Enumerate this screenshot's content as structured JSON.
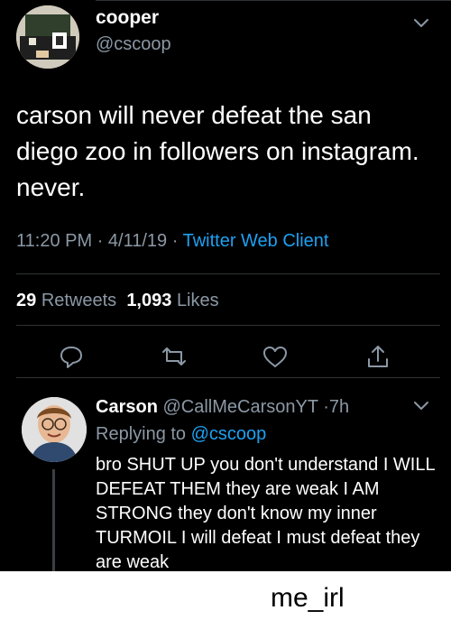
{
  "tweet": {
    "author_name": "cooper",
    "author_handle": "@cscoop",
    "text": "carson will never defeat the san diego zoo in followers on instagram. never.",
    "time": "11:20 PM",
    "date": "4/11/19",
    "source": "Twitter Web Client",
    "retweet_count": "29",
    "retweet_label": "Retweets",
    "like_count": "1,093",
    "like_label": "Likes"
  },
  "reply": {
    "author_name": "Carson",
    "author_handle": "@CallMeCarsonYT",
    "age": "7h",
    "replying_label": "Replying to",
    "replying_to": "@cscoop",
    "text": "bro SHUT UP you don't understand I WILL DEFEAT THEM they are weak I AM STRONG they don't know my inner TURMOIL I will defeat I must defeat they are weak"
  },
  "caption": "me_irl",
  "icons": [
    "chevron-down-icon",
    "reply-icon",
    "retweet-icon",
    "like-icon",
    "share-icon"
  ],
  "colors": {
    "background": "#000000",
    "text": "#ffffff",
    "muted": "#8b98a5",
    "link": "#1da1f2",
    "divider": "#2f3336"
  }
}
